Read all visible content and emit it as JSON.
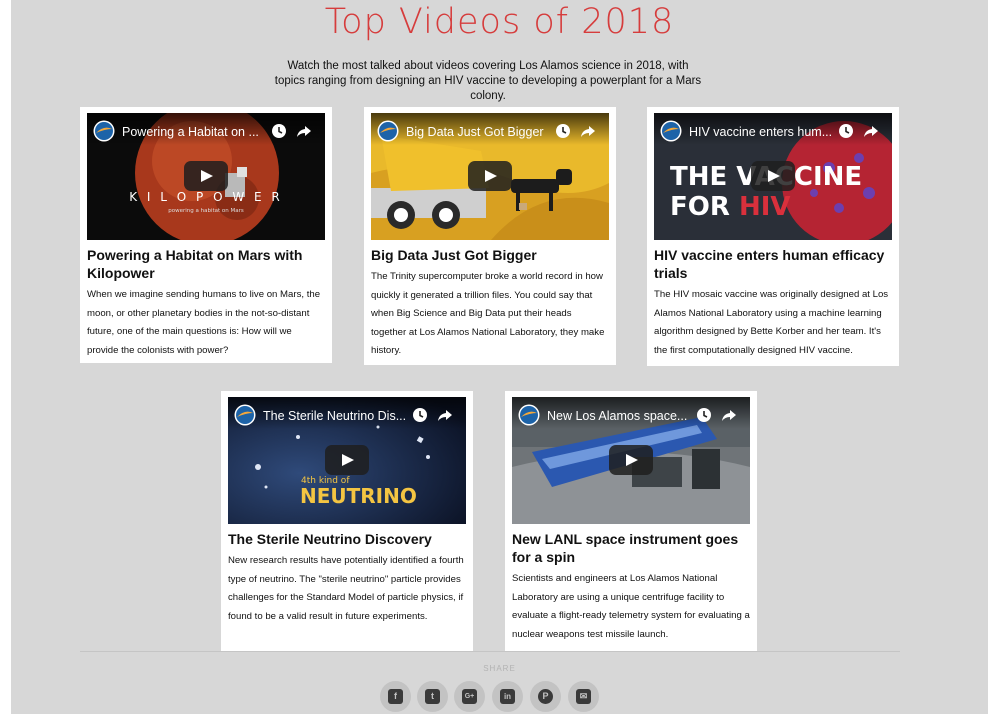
{
  "header": {
    "title": "Top Videos of 2018",
    "intro": "Watch the most talked about videos covering Los Alamos science in 2018, with topics ranging from designing an HIV vaccine to developing a powerplant for a Mars colony."
  },
  "cards": [
    {
      "video_title": "Powering a Habitat on ...",
      "title": "Powering a Habitat on Mars with Kilopower",
      "description": "When we imagine sending humans to live on Mars, the moon, or other planetary bodies in the not-so-distant future, one of the main questions is: How will we provide the colonists with power?",
      "overlay_big": "K I L O P O W E R",
      "overlay_small": "powering a habitat on Mars"
    },
    {
      "video_title": "Big Data Just Got Bigger",
      "title": "Big Data Just Got Bigger",
      "description": "The Trinity supercomputer broke a world record in how quickly it generated a trillion files. You could say that when Big Science and Big Data put their heads together at Los Alamos National Laboratory, they make history."
    },
    {
      "video_title": "HIV vaccine enters hum...",
      "title": "HIV vaccine enters human efficacy trials",
      "description": "The HIV mosaic vaccine was originally designed at Los Alamos National Laboratory using a machine learning algorithm designed by Bette Korber and her team. It's the first computationally designed HIV vaccine.",
      "overlay_line1": "THE VACCINE",
      "overlay_line2a": "FOR ",
      "overlay_line2b": "HIV"
    },
    {
      "video_title": "The Sterile Neutrino Dis...",
      "title": "The Sterile Neutrino Discovery",
      "description": "New research results have potentially identified a fourth type of neutrino. The \"sterile neutrino\" particle provides challenges for the Standard Model of particle physics, if found to be a valid result in future experiments.",
      "overlay_small": "4th kind of",
      "overlay_big": "NEUTRINO"
    },
    {
      "video_title": "New Los Alamos space...",
      "title": "New LANL space instrument goes for a spin",
      "description": "Scientists and engineers at Los Alamos National Laboratory are using a unique centrifuge facility to evaluate a flight-ready telemetry system for evaluating a nuclear weapons test missile launch."
    }
  ],
  "share": {
    "label": "SHARE",
    "buttons": [
      {
        "icon": "facebook-icon",
        "glyph": "f"
      },
      {
        "icon": "twitter-icon",
        "glyph": "t"
      },
      {
        "icon": "google-plus-icon",
        "glyph": "G+"
      },
      {
        "icon": "linkedin-icon",
        "glyph": "in"
      },
      {
        "icon": "pinterest-icon",
        "glyph": "P"
      },
      {
        "icon": "email-icon",
        "glyph": "✉"
      }
    ]
  },
  "colors": {
    "title_red": "#d63c3c",
    "page_bg": "#d7d7d7",
    "card_bg": "#ffffff"
  }
}
